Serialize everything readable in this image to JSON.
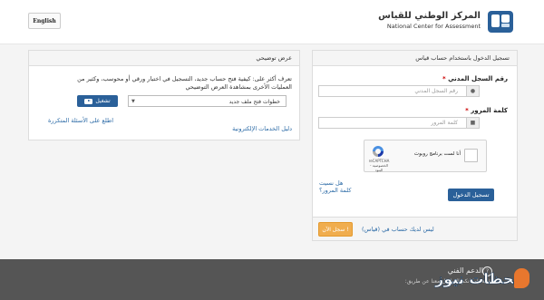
{
  "header": {
    "lang_button": "English",
    "org_name_ar": "المركز الوطني للقياس",
    "org_name_en": "National Center for Assessment"
  },
  "intro": {
    "title": "عرض توضيحي",
    "description": "تعرف أكثر على: كيفية فتح حساب جديد، التسجيل في اختبار ورقي أو محوسب، وكثير من العمليات الأخرى بمشاهدة العرض التوضيحي",
    "select_value": "خطوات فتح ملف جديد",
    "play_button": "تشغيل",
    "faq_link": "اطلع على الأسئلة المتكررة",
    "eservices_link": "دليل الخدمات الإلكترونية"
  },
  "login": {
    "title": "تسجيل الدخول باستخدام حساب قياس",
    "civil_id_label": "رقم السجل المدني",
    "civil_id_placeholder": "رقم السجل المدني",
    "password_label": "كلمة المرور",
    "password_placeholder": "كلمة المرور",
    "required_mark": "*",
    "captcha_label": "أنا لست برنامج روبوت",
    "captcha_brand": "reCAPTCHA",
    "captcha_terms": "الخصوصية - البنود",
    "forgot_link": "هل نسيت كلمة المرور؟",
    "submit_button": "تسجيل الدخول",
    "no_account_text": "ليس لديك حساب في (قياس)",
    "register_button": "سجل الآن !"
  },
  "footer": {
    "support_title": "الدعم الفني",
    "support_text": "تقنية بإمكانكم التواصل معنا عن طريق:",
    "watermark": "لحظات نيوز"
  },
  "colors": {
    "primary": "#2a6099",
    "link": "#2b6aa6",
    "warning": "#f0ad4e",
    "required": "#cc0000",
    "footer_bg": "#555555"
  }
}
